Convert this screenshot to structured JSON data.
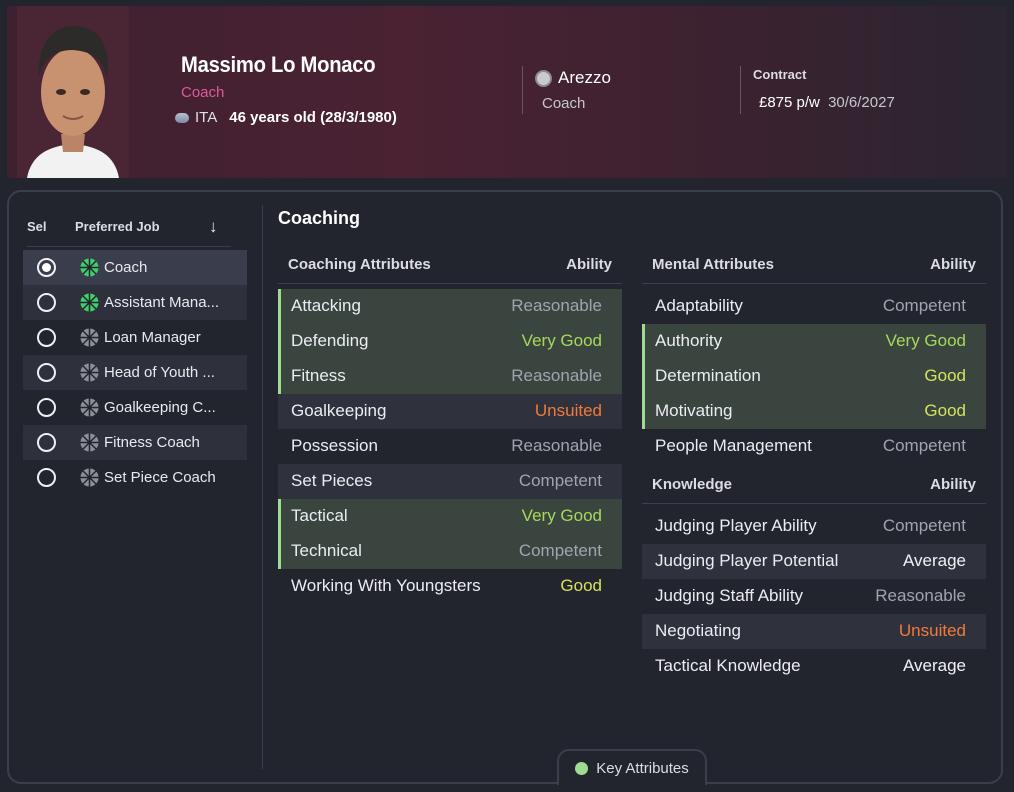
{
  "header": {
    "name": "Massimo Lo Monaco",
    "role": "Coach",
    "nationality": "ITA",
    "age_text": "46 years old (28/3/1980)",
    "club": "Arezzo",
    "club_role": "Coach",
    "contract_label": "Contract",
    "wage": "£875 p/w",
    "expiry": "30/6/2027"
  },
  "jobs": {
    "sel_header": "Sel",
    "pref_header": "Preferred Job",
    "items": [
      {
        "label": "Coach",
        "selected": true,
        "icon_color": "#3ecf6a"
      },
      {
        "label": "Assistant Mana...",
        "selected": false,
        "icon_color": "#3ecf6a"
      },
      {
        "label": "Loan Manager",
        "selected": false,
        "icon_color": "#8e9099"
      },
      {
        "label": "Head of Youth ...",
        "selected": false,
        "icon_color": "#8e9099"
      },
      {
        "label": "Goalkeeping C...",
        "selected": false,
        "icon_color": "#8e9099"
      },
      {
        "label": "Fitness Coach",
        "selected": false,
        "icon_color": "#8e9099"
      },
      {
        "label": "Set Piece Coach",
        "selected": false,
        "icon_color": "#8e9099"
      }
    ]
  },
  "section_title": "Coaching",
  "coaching": {
    "header": "Coaching Attributes",
    "ability_header": "Ability",
    "rows": [
      {
        "name": "Attacking",
        "value": "Reasonable",
        "key": true
      },
      {
        "name": "Defending",
        "value": "Very Good",
        "key": true
      },
      {
        "name": "Fitness",
        "value": "Reasonable",
        "key": true
      },
      {
        "name": "Goalkeeping",
        "value": "Unsuited",
        "key": false
      },
      {
        "name": "Possession",
        "value": "Reasonable",
        "key": false
      },
      {
        "name": "Set Pieces",
        "value": "Competent",
        "key": false
      },
      {
        "name": "Tactical",
        "value": "Very Good",
        "key": true
      },
      {
        "name": "Technical",
        "value": "Competent",
        "key": true
      },
      {
        "name": "Working With Youngsters",
        "value": "Good",
        "key": false
      }
    ]
  },
  "mental": {
    "header": "Mental Attributes",
    "ability_header": "Ability",
    "rows": [
      {
        "name": "Adaptability",
        "value": "Competent",
        "key": false
      },
      {
        "name": "Authority",
        "value": "Very Good",
        "key": true
      },
      {
        "name": "Determination",
        "value": "Good",
        "key": true
      },
      {
        "name": "Motivating",
        "value": "Good",
        "key": true
      },
      {
        "name": "People Management",
        "value": "Competent",
        "key": false
      }
    ]
  },
  "knowledge": {
    "header": "Knowledge",
    "ability_header": "Ability",
    "rows": [
      {
        "name": "Judging Player Ability",
        "value": "Competent",
        "key": false
      },
      {
        "name": "Judging Player Potential",
        "value": "Average",
        "key": false
      },
      {
        "name": "Judging Staff Ability",
        "value": "Reasonable",
        "key": false
      },
      {
        "name": "Negotiating",
        "value": "Unsuited",
        "key": false
      },
      {
        "name": "Tactical Knowledge",
        "value": "Average",
        "key": false
      }
    ]
  },
  "key_attributes_label": "Key Attributes",
  "colors": {
    "key_highlight": "#9fdc8f",
    "role_pink": "#e0589e",
    "very_good": "#a8d85a",
    "good": "#d6e35a",
    "unsuited": "#f07a3a"
  }
}
